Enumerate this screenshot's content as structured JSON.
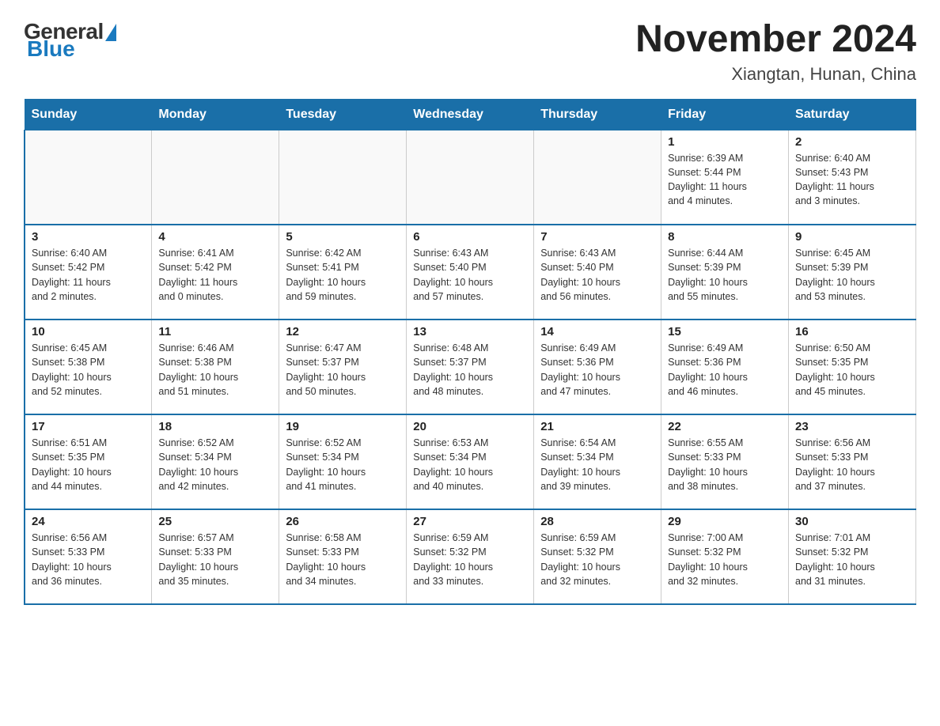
{
  "header": {
    "logo_general": "General",
    "logo_blue": "Blue",
    "month_year": "November 2024",
    "location": "Xiangtan, Hunan, China"
  },
  "days_of_week": [
    "Sunday",
    "Monday",
    "Tuesday",
    "Wednesday",
    "Thursday",
    "Friday",
    "Saturday"
  ],
  "weeks": [
    [
      {
        "day": "",
        "info": ""
      },
      {
        "day": "",
        "info": ""
      },
      {
        "day": "",
        "info": ""
      },
      {
        "day": "",
        "info": ""
      },
      {
        "day": "",
        "info": ""
      },
      {
        "day": "1",
        "info": "Sunrise: 6:39 AM\nSunset: 5:44 PM\nDaylight: 11 hours\nand 4 minutes."
      },
      {
        "day": "2",
        "info": "Sunrise: 6:40 AM\nSunset: 5:43 PM\nDaylight: 11 hours\nand 3 minutes."
      }
    ],
    [
      {
        "day": "3",
        "info": "Sunrise: 6:40 AM\nSunset: 5:42 PM\nDaylight: 11 hours\nand 2 minutes."
      },
      {
        "day": "4",
        "info": "Sunrise: 6:41 AM\nSunset: 5:42 PM\nDaylight: 11 hours\nand 0 minutes."
      },
      {
        "day": "5",
        "info": "Sunrise: 6:42 AM\nSunset: 5:41 PM\nDaylight: 10 hours\nand 59 minutes."
      },
      {
        "day": "6",
        "info": "Sunrise: 6:43 AM\nSunset: 5:40 PM\nDaylight: 10 hours\nand 57 minutes."
      },
      {
        "day": "7",
        "info": "Sunrise: 6:43 AM\nSunset: 5:40 PM\nDaylight: 10 hours\nand 56 minutes."
      },
      {
        "day": "8",
        "info": "Sunrise: 6:44 AM\nSunset: 5:39 PM\nDaylight: 10 hours\nand 55 minutes."
      },
      {
        "day": "9",
        "info": "Sunrise: 6:45 AM\nSunset: 5:39 PM\nDaylight: 10 hours\nand 53 minutes."
      }
    ],
    [
      {
        "day": "10",
        "info": "Sunrise: 6:45 AM\nSunset: 5:38 PM\nDaylight: 10 hours\nand 52 minutes."
      },
      {
        "day": "11",
        "info": "Sunrise: 6:46 AM\nSunset: 5:38 PM\nDaylight: 10 hours\nand 51 minutes."
      },
      {
        "day": "12",
        "info": "Sunrise: 6:47 AM\nSunset: 5:37 PM\nDaylight: 10 hours\nand 50 minutes."
      },
      {
        "day": "13",
        "info": "Sunrise: 6:48 AM\nSunset: 5:37 PM\nDaylight: 10 hours\nand 48 minutes."
      },
      {
        "day": "14",
        "info": "Sunrise: 6:49 AM\nSunset: 5:36 PM\nDaylight: 10 hours\nand 47 minutes."
      },
      {
        "day": "15",
        "info": "Sunrise: 6:49 AM\nSunset: 5:36 PM\nDaylight: 10 hours\nand 46 minutes."
      },
      {
        "day": "16",
        "info": "Sunrise: 6:50 AM\nSunset: 5:35 PM\nDaylight: 10 hours\nand 45 minutes."
      }
    ],
    [
      {
        "day": "17",
        "info": "Sunrise: 6:51 AM\nSunset: 5:35 PM\nDaylight: 10 hours\nand 44 minutes."
      },
      {
        "day": "18",
        "info": "Sunrise: 6:52 AM\nSunset: 5:34 PM\nDaylight: 10 hours\nand 42 minutes."
      },
      {
        "day": "19",
        "info": "Sunrise: 6:52 AM\nSunset: 5:34 PM\nDaylight: 10 hours\nand 41 minutes."
      },
      {
        "day": "20",
        "info": "Sunrise: 6:53 AM\nSunset: 5:34 PM\nDaylight: 10 hours\nand 40 minutes."
      },
      {
        "day": "21",
        "info": "Sunrise: 6:54 AM\nSunset: 5:34 PM\nDaylight: 10 hours\nand 39 minutes."
      },
      {
        "day": "22",
        "info": "Sunrise: 6:55 AM\nSunset: 5:33 PM\nDaylight: 10 hours\nand 38 minutes."
      },
      {
        "day": "23",
        "info": "Sunrise: 6:56 AM\nSunset: 5:33 PM\nDaylight: 10 hours\nand 37 minutes."
      }
    ],
    [
      {
        "day": "24",
        "info": "Sunrise: 6:56 AM\nSunset: 5:33 PM\nDaylight: 10 hours\nand 36 minutes."
      },
      {
        "day": "25",
        "info": "Sunrise: 6:57 AM\nSunset: 5:33 PM\nDaylight: 10 hours\nand 35 minutes."
      },
      {
        "day": "26",
        "info": "Sunrise: 6:58 AM\nSunset: 5:33 PM\nDaylight: 10 hours\nand 34 minutes."
      },
      {
        "day": "27",
        "info": "Sunrise: 6:59 AM\nSunset: 5:32 PM\nDaylight: 10 hours\nand 33 minutes."
      },
      {
        "day": "28",
        "info": "Sunrise: 6:59 AM\nSunset: 5:32 PM\nDaylight: 10 hours\nand 32 minutes."
      },
      {
        "day": "29",
        "info": "Sunrise: 7:00 AM\nSunset: 5:32 PM\nDaylight: 10 hours\nand 32 minutes."
      },
      {
        "day": "30",
        "info": "Sunrise: 7:01 AM\nSunset: 5:32 PM\nDaylight: 10 hours\nand 31 minutes."
      }
    ]
  ]
}
